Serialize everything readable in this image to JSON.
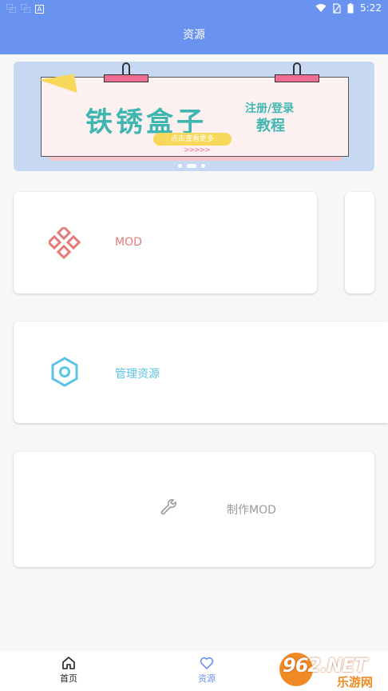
{
  "status_bar": {
    "left_icons": [
      "app-notification-icon",
      "app-notification-icon",
      "a-box-icon"
    ],
    "time": "5:22",
    "right_icons": [
      "wifi-icon",
      "no-sim-icon",
      "battery-icon"
    ]
  },
  "header": {
    "title": "资源"
  },
  "banner": {
    "title": "铁锈盒子",
    "subtitle_line1": "注册/登录",
    "subtitle_line2": "教程",
    "pill_text": "点击查看更多",
    "arrows": ">>>>>",
    "slide_count": 3,
    "active_slide": 2
  },
  "cards": {
    "mod": {
      "label": "MOD",
      "icon": "diamond-cluster-icon",
      "color": "#e57c78"
    },
    "manage": {
      "label": "管理资源",
      "icon": "hexagon-nut-icon",
      "color": "#5bc3e3"
    },
    "make": {
      "label": "制作MOD",
      "icon": "wrench-icon",
      "color": "#9a9a9a"
    }
  },
  "bottom_nav": {
    "items": [
      {
        "label": "首页",
        "icon": "home-icon",
        "active": false
      },
      {
        "label": "资源",
        "icon": "heart-icon",
        "active": true
      }
    ],
    "active_color": "#6a93f0"
  },
  "watermark": {
    "brand": "962.NET",
    "text": "乐游网"
  }
}
